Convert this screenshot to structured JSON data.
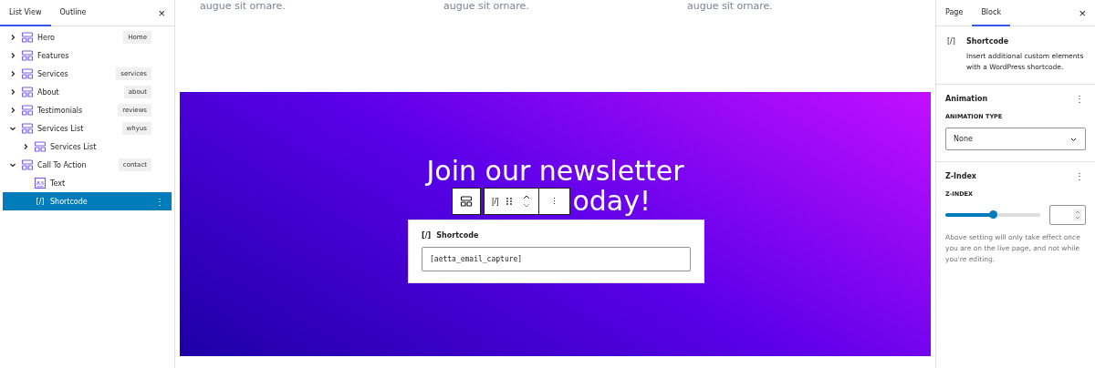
{
  "left_panel": {
    "tabs": [
      {
        "label": "List View",
        "selected": true
      },
      {
        "label": "Outline",
        "selected": false
      }
    ],
    "close": "×",
    "tree": [
      {
        "label": "Hero",
        "badge": "Home",
        "expanded": false,
        "kind": "group",
        "selected": false
      },
      {
        "label": "Features",
        "expanded": false,
        "kind": "group",
        "selected": false
      },
      {
        "label": "Services",
        "badge": "services",
        "expanded": false,
        "kind": "group",
        "selected": false
      },
      {
        "label": "About",
        "badge": "about",
        "expanded": false,
        "kind": "group",
        "selected": false
      },
      {
        "label": "Testimonials",
        "badge": "reviews",
        "expanded": false,
        "kind": "group",
        "selected": false
      },
      {
        "label": "Services List",
        "badge": "whyus",
        "expanded": true,
        "kind": "group",
        "selected": false,
        "children": [
          {
            "label": "Services List",
            "expanded": false,
            "kind": "group",
            "selected": false
          }
        ]
      },
      {
        "label": "Call To Action",
        "badge": "contact",
        "expanded": true,
        "kind": "group",
        "selected": false,
        "children": [
          {
            "label": "Text",
            "kind": "text",
            "selected": false
          },
          {
            "label": "Shortcode",
            "kind": "shortcode",
            "glyph": "[/]",
            "selected": true,
            "more": "⋮"
          }
        ]
      }
    ]
  },
  "canvas": {
    "columns_text": [
      "augue sit ornare.",
      "augue sit ornare.",
      "augue sit ornare."
    ],
    "section": {
      "heading_line_1": "Join our newsletter",
      "heading_line_2_visible": "oday!",
      "toolbar": {
        "block_glyph": "[/]",
        "more": "⋮"
      },
      "shortcode_block": {
        "title": "Shortcode",
        "glyph": "[/]",
        "value": "[aetta_email_capture]"
      }
    }
  },
  "right_panel": {
    "tabs": [
      {
        "label": "Page",
        "selected": false
      },
      {
        "label": "Block",
        "selected": true
      }
    ],
    "close": "×",
    "block": {
      "glyph": "[/]",
      "title": "Shortcode",
      "description": "Insert additional custom elements with a WordPress shortcode."
    },
    "animation": {
      "title": "Animation",
      "more": "⋮",
      "field_label": "ANIMATION TYPE",
      "value": "None"
    },
    "zindex": {
      "title": "Z-Index",
      "more": "⋮",
      "field_label": "Z-INDEX",
      "level": 0.5,
      "help": "Above setting will only take effect once you are on the live page, and not while you're editing."
    }
  }
}
